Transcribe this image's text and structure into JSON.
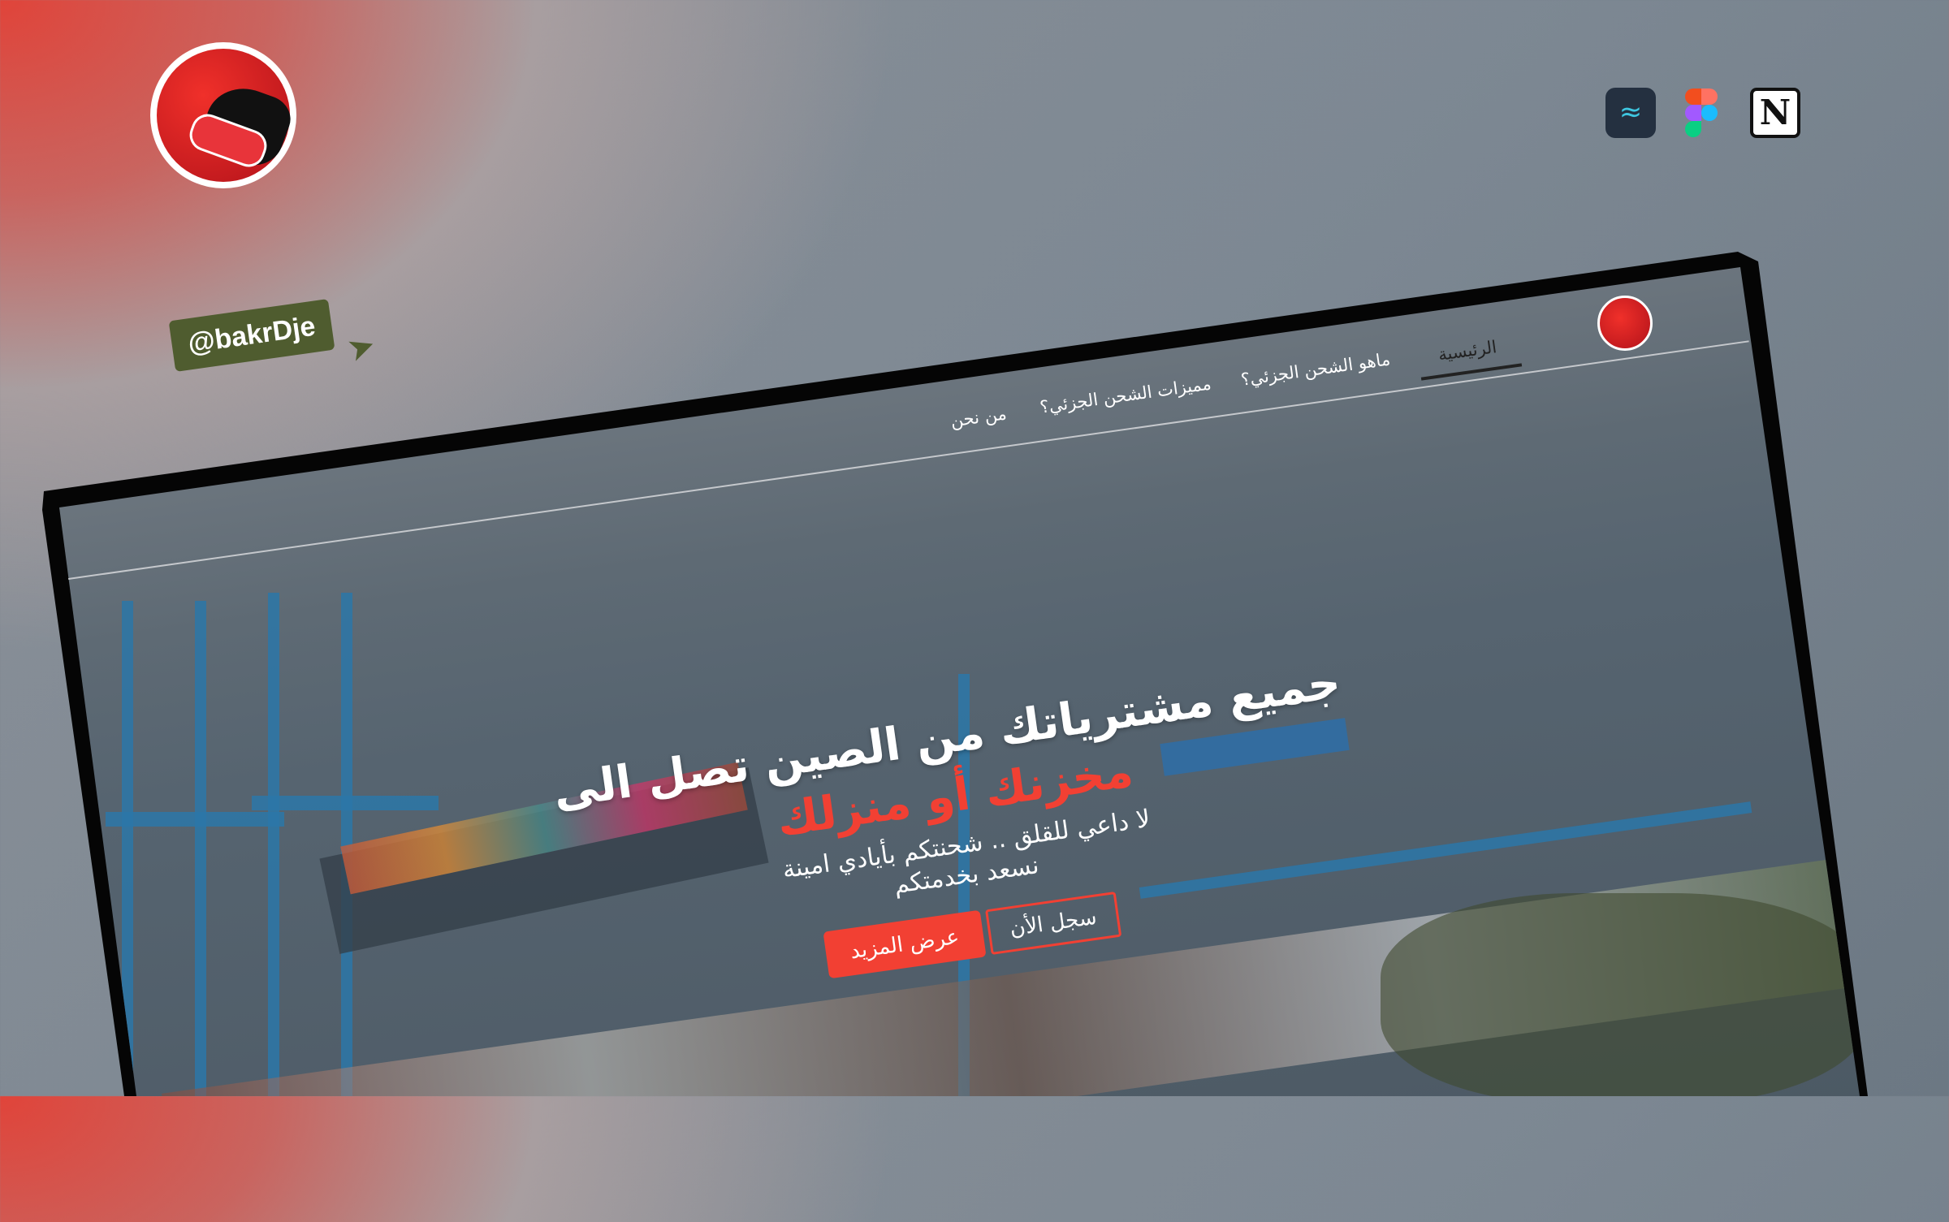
{
  "handle": "@bakrDje",
  "tools": [
    {
      "name": "tailwind",
      "icon": "tailwind-icon"
    },
    {
      "name": "figma",
      "icon": "figma-icon"
    },
    {
      "name": "notion",
      "icon": "notion-icon",
      "glyph": "N"
    }
  ],
  "site": {
    "nav": [
      {
        "label": "الرئيسية",
        "active": true
      },
      {
        "label": "ماهو الشحن الجزئي؟"
      },
      {
        "label": "مميزات الشحن الجزئي؟"
      },
      {
        "label": "من نحن"
      }
    ],
    "hero": {
      "title": "جميع مشترياتك من الصين تصل الى",
      "highlight": "مخزنك أو منزلك",
      "subtitle_line1": "لا داعي للقلق .. شحنتكم بأيادي امينة",
      "subtitle_line2": "نسعد بخدمتكم",
      "more_button": "عرض المزيد",
      "register_button": "سجل الأن"
    }
  },
  "colors": {
    "accent": "#f24033",
    "handle_bg": "#4f5c2f"
  }
}
